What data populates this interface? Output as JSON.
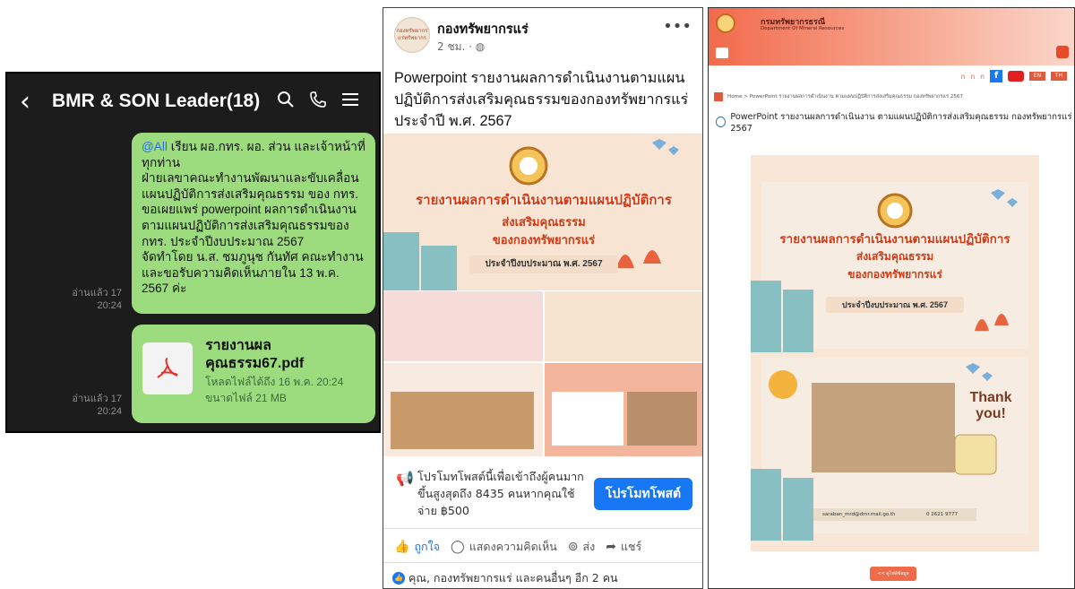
{
  "line_chat": {
    "title": "BMR & SON Leader(18)",
    "message": {
      "mention": "@All",
      "text": " เรียน ผอ.กทร. ผอ. ส่วน และเจ้าหน้าที่ทุกท่าน\nฝ่ายเลขาคณะทำงานพัฒนาและขับเคลื่อนแผนปฏิบัติการส่งเสริมคุณธรรม ของ กทร. ขอเผยแพร่ powerpoint ผลการดำเนินงานตามแผนปฏิบัติการส่งเสริมคุณธรรมของ กทร. ประจำปีงบประมาณ 2567\nจัดทำโดย น.ส. ชมภูนุช กันทัศ คณะทำงาน และขอรับความคิดเห็นภายใน 13 พ.ค. 2567 ค่ะ",
      "read_status": "อ่านแล้ว 17",
      "time": "20:24"
    },
    "file": {
      "name": "รายงานผลคุณธรรม67.pdf",
      "download_until": "โหลดไฟล์ได้ถึง 16 พ.ค. 20:24",
      "size": "ขนาดไฟล์ 21 MB",
      "read_status": "อ่านแล้ว 17",
      "time": "20:24"
    }
  },
  "facebook": {
    "page_name": "กองทรัพยากรแร่",
    "avatar_text": "กองทรัพยากร แร่ทรัพยากร",
    "post_time": "2 ชม. · ",
    "post_text": "Powerpoint รายงานผลการดำเนินงานตามแผนปฏิบัติการส่งเสริมคุณธรรมของกองทรัพยากรแร่ประจำปี พ.ศ. 2567",
    "promote_text": "โปรโมทโพสต์นี้เพื่อเข้าถึงผู้คนมากขึ้นสูงสุดถึง 8435 คนหากคุณใช้จ่าย ฿500",
    "promote_button": "โปรโมทโพสต์",
    "actions": {
      "like": "ถูกใจ",
      "comment": "แสดงความคิดเห็น",
      "send": "ส่ง",
      "share": "แชร์"
    },
    "reactions_text": "คุณ, กองทรัพยากรแร่ และคนอื่นๆ อีก 2 คน"
  },
  "slide": {
    "title": "รายงานผลการดำเนินงานตามแผนปฏิบัติการ",
    "sub1": "ส่งเสริมคุณธรรม",
    "sub2": "ของกองทรัพยากรแร่",
    "year": "ประจำปีงบประมาณ พ.ศ. 2567",
    "thank": "Thank you!",
    "email": "saraban_mrd@dmr.mail.go.th",
    "phone": "0 2621 9777"
  },
  "website": {
    "org_title": "กรมทรัพยากรธรณี",
    "org_sub": "Department Of Mineral Resources",
    "font_size_labels": [
      "ก",
      "ก",
      "ก"
    ],
    "lang_th": "TH",
    "lang_en": "EN",
    "breadcrumb": "Home > PowerPoint รายงานผลการดำเนินงาน ตามแผนปฏิบัติการส่งเสริมคุณธรรม กองทรัพยากรแร่ 2567",
    "heading": "PowerPoint รายงานผลการดำเนินงาน ตามแผนปฏิบัติการส่งเสริมคุณธรรม กองทรัพยากรแร่ 2567",
    "pager": "<< ดูไฟล์ข้อมูล"
  },
  "colors": {
    "line_bg": "#1c1c1c",
    "line_bubble": "#9ddc7e",
    "fb_blue": "#1877f2",
    "slide_red": "#d03a14",
    "web_orange": "#f26a4b"
  }
}
